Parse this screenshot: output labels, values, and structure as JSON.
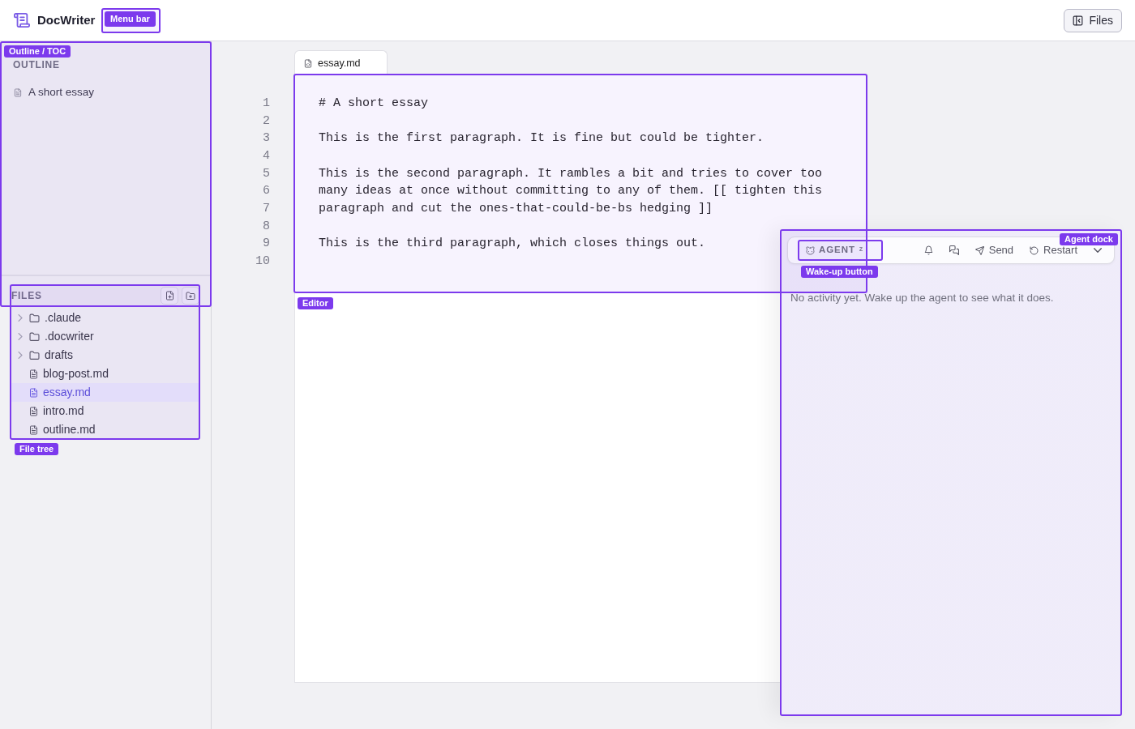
{
  "menu_bar": {
    "app_name": "DocWriter",
    "files_button": "Files"
  },
  "outline": {
    "title": "OUTLINE",
    "items": [
      {
        "label": "A short essay"
      }
    ]
  },
  "files": {
    "title": "FILES",
    "tree": [
      {
        "name": ".claude",
        "kind": "folder",
        "expanded": false,
        "selected": false
      },
      {
        "name": ".docwriter",
        "kind": "folder",
        "expanded": false,
        "selected": false
      },
      {
        "name": "drafts",
        "kind": "folder",
        "expanded": false,
        "selected": false
      },
      {
        "name": "blog-post.md",
        "kind": "file",
        "selected": false
      },
      {
        "name": "essay.md",
        "kind": "file",
        "selected": true
      },
      {
        "name": "intro.md",
        "kind": "file",
        "selected": false
      },
      {
        "name": "outline.md",
        "kind": "file",
        "selected": false
      }
    ]
  },
  "editor": {
    "tabs": [
      {
        "label": "essay.md",
        "selected": true
      }
    ],
    "lines": [
      {
        "number": "1",
        "text": "# A short essay"
      },
      {
        "number": "2"
      },
      {
        "number": "3",
        "text": "This is the first paragraph. It is fine but could be tighter."
      },
      {
        "number": "4"
      },
      {
        "number": "5",
        "text": "This is the second paragraph. It rambles a bit and tries to cover too"
      },
      {
        "number": "6",
        "text": "many ideas at once without committing to any of them. [[ tighten this"
      },
      {
        "number": "7",
        "text": "paragraph and cut the ones-that-could-be-bs hedging ]]"
      },
      {
        "number": "8"
      },
      {
        "number": "9",
        "text": "This is the third paragraph, which closes things out."
      },
      {
        "number": "10"
      }
    ]
  },
  "agent_dock": {
    "agent_button": {
      "label": "AGENT",
      "badge": "z"
    },
    "send_button": "Send",
    "restart_button": "Restart",
    "message": "No activity yet. Wake up the agent to see what it does."
  },
  "annotations": [
    {
      "label": "Menu bar"
    },
    {
      "label": "Outline / TOC"
    },
    {
      "label": "Editor"
    },
    {
      "label": "File tree"
    },
    {
      "label": "Wake-up button"
    },
    {
      "label": "Agent dock"
    }
  ]
}
